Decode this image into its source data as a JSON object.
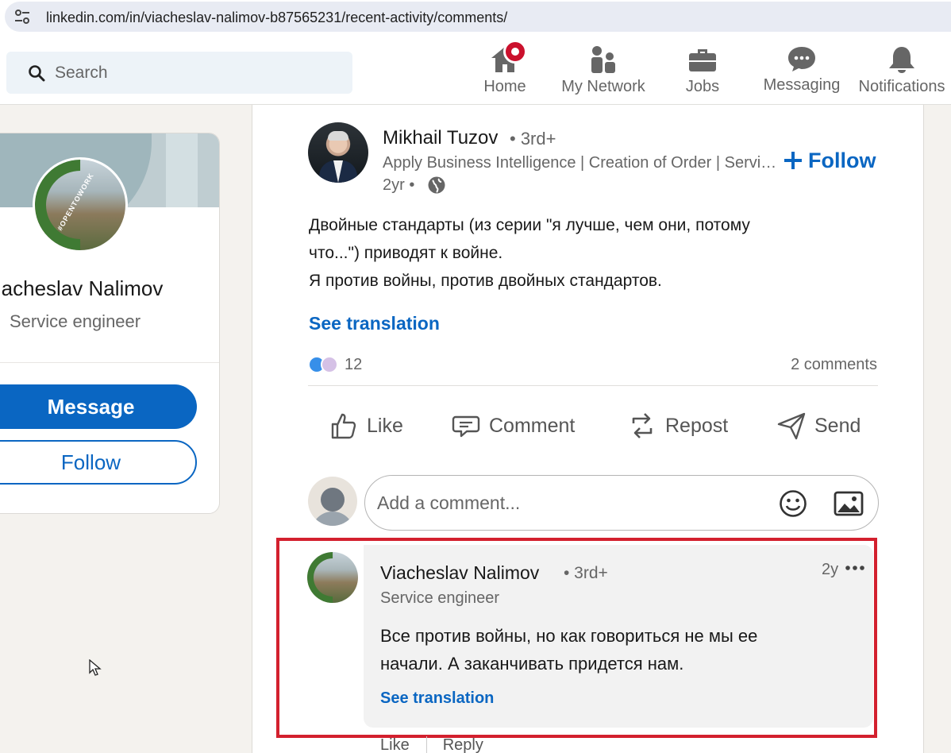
{
  "browser": {
    "url": "linkedin.com/in/viacheslav-nalimov-b87565231/recent-activity/comments/",
    "site_icon": "tune-icon"
  },
  "nav": {
    "search_placeholder": "Search",
    "items": [
      {
        "label": "Home",
        "icon": "home-icon",
        "badge": true
      },
      {
        "label": "My Network",
        "icon": "network-icon"
      },
      {
        "label": "Jobs",
        "icon": "briefcase-icon"
      },
      {
        "label": "Messaging",
        "icon": "messaging-icon"
      },
      {
        "label": "Notifications",
        "icon": "bell-icon"
      }
    ]
  },
  "profile": {
    "name": "Viacheslav Nalimov",
    "title": "Service engineer",
    "badge_text": "#OPENTOWORK",
    "message_label": "Message",
    "follow_label": "Follow"
  },
  "post": {
    "author_name": "Mikhail Tuzov",
    "author_degree": "• 3rd+",
    "author_headline": "Apply Business Intelligence | Creation of Order | Service Management",
    "time": "2yr •",
    "follow_label": "Follow",
    "text_lines": [
      "Двойные стандарты (из серии \"я лучше, чем они, потому",
      "что...\") приводят к войне.",
      "Я против войны, против двойных стандартов."
    ],
    "see_translation": "See translation",
    "reactions_count": "12",
    "comments_count": "2 comments",
    "actions": {
      "like": "Like",
      "comment": "Comment",
      "repost": "Repost",
      "send": "Send"
    },
    "comment_placeholder": "Add a comment..."
  },
  "comment": {
    "author_name": "Viacheslav Nalimov",
    "author_degree": "• 3rd+",
    "author_title": "Service engineer",
    "time": "2y",
    "text_lines": [
      "Все против войны, но как говориться не мы ее",
      "начали. А заканчивать придется нам."
    ],
    "see_translation": "See translation",
    "like_label": "Like",
    "reply_label": "Reply"
  },
  "colors": {
    "brand_blue": "#0a66c2",
    "highlight_red": "#d3202e",
    "badge_red": "#cb112d"
  }
}
